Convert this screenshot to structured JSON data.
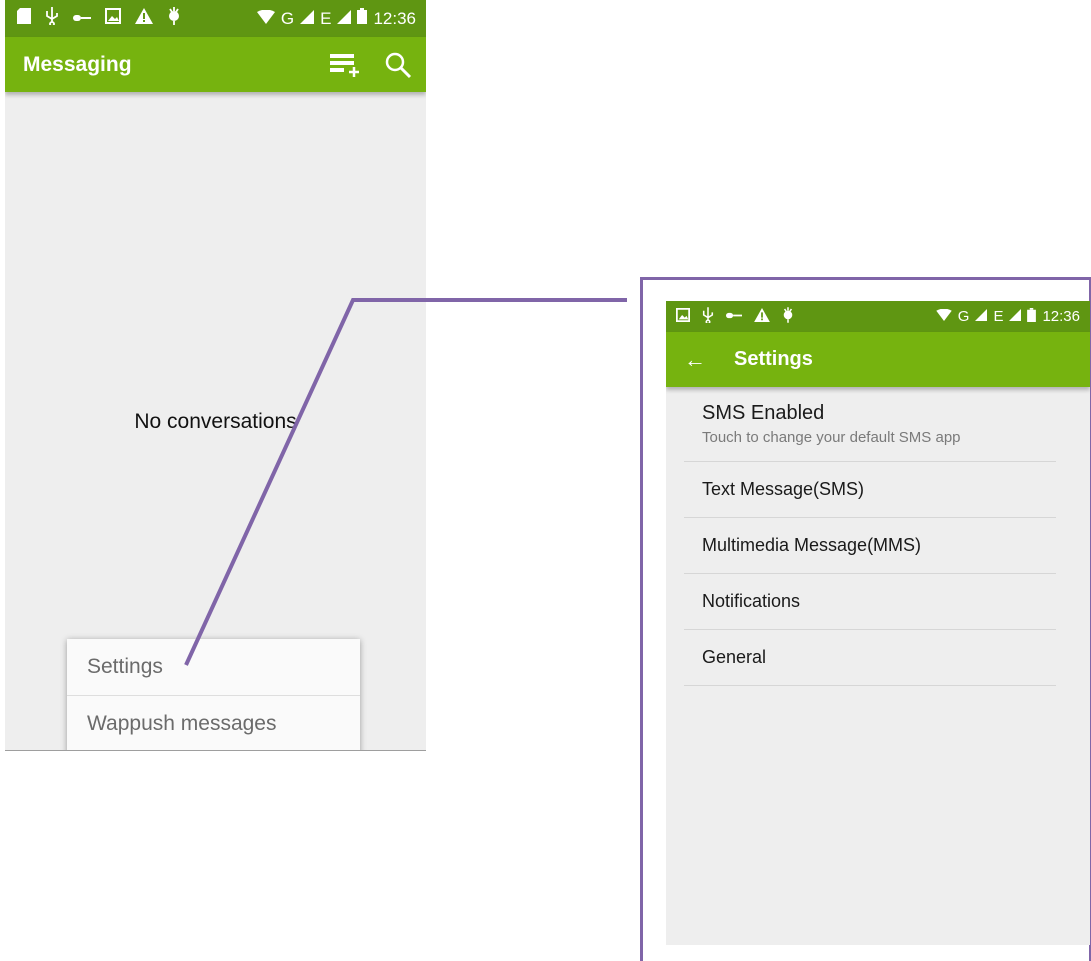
{
  "colors": {
    "statusbar": "#5f9612",
    "appbar": "#76b30f",
    "background": "#eeeeee",
    "callout": "#8065a8"
  },
  "messaging": {
    "statusbar": {
      "left_icons": [
        "sd-card-icon",
        "usb-icon",
        "nfc-icon",
        "image-icon",
        "warning-icon",
        "android-debug-icon"
      ],
      "network": "G",
      "network2": "E",
      "time": "12:36"
    },
    "title": "Messaging",
    "actions": [
      "new-message-icon",
      "search-icon"
    ],
    "empty_text": "No conversations",
    "menu": [
      {
        "label": "Settings"
      },
      {
        "label": "Wappush messages"
      }
    ]
  },
  "settings": {
    "statusbar": {
      "left_icons": [
        "image-icon",
        "usb-icon",
        "nfc-icon",
        "warning-icon",
        "android-debug-icon"
      ],
      "network": "G",
      "network2": "E",
      "time": "12:36"
    },
    "back_icon": "back-arrow-icon",
    "title": "Settings",
    "items": [
      {
        "title": "SMS Enabled",
        "summary": "Touch to change your default SMS app"
      },
      {
        "title": "Text Message(SMS)"
      },
      {
        "title": "Multimedia Message(MMS)"
      },
      {
        "title": "Notifications"
      },
      {
        "title": "General"
      }
    ]
  }
}
